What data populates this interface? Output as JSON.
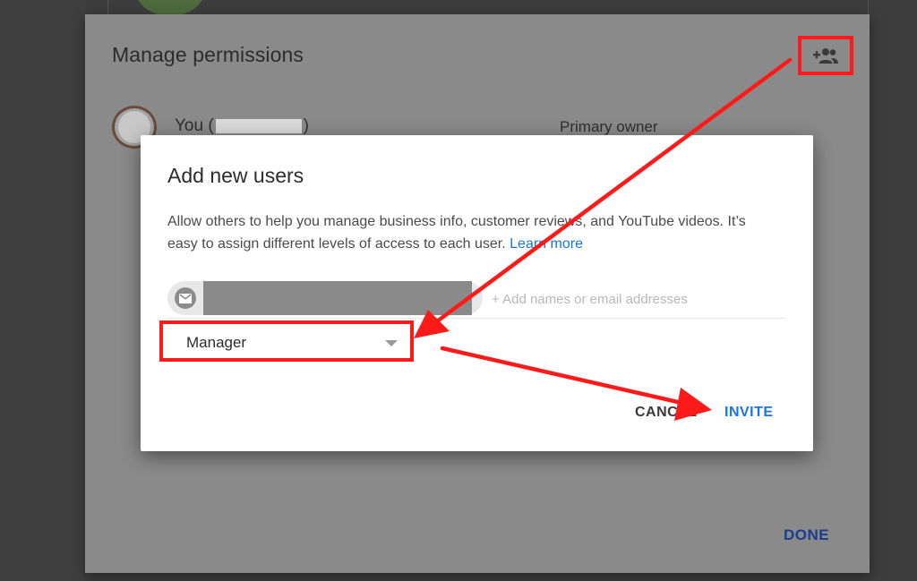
{
  "permissions_dialog": {
    "title": "Manage permissions",
    "owner": {
      "name_prefix": "You (",
      "name_suffix": ")",
      "role": "Primary owner"
    },
    "done_label": "DONE"
  },
  "add_users_dialog": {
    "title": "Add new users",
    "description": "Allow others to help you manage business info, customer reviews, and YouTube videos. It’s easy to assign different levels of access to each user.",
    "learn_more": "Learn more",
    "email_placeholder": "+ Add names or email addresses",
    "role_selected": "Manager",
    "cancel_label": "CANCEL",
    "invite_label": "INVITE"
  },
  "icons": {
    "add_user": "person-add-icon",
    "email_chip": "mail-icon",
    "dropdown": "caret-down-icon"
  },
  "colors": {
    "accent": "#1a73e8",
    "annotation": "#ff1a1a",
    "done": "#1a3d8f"
  }
}
